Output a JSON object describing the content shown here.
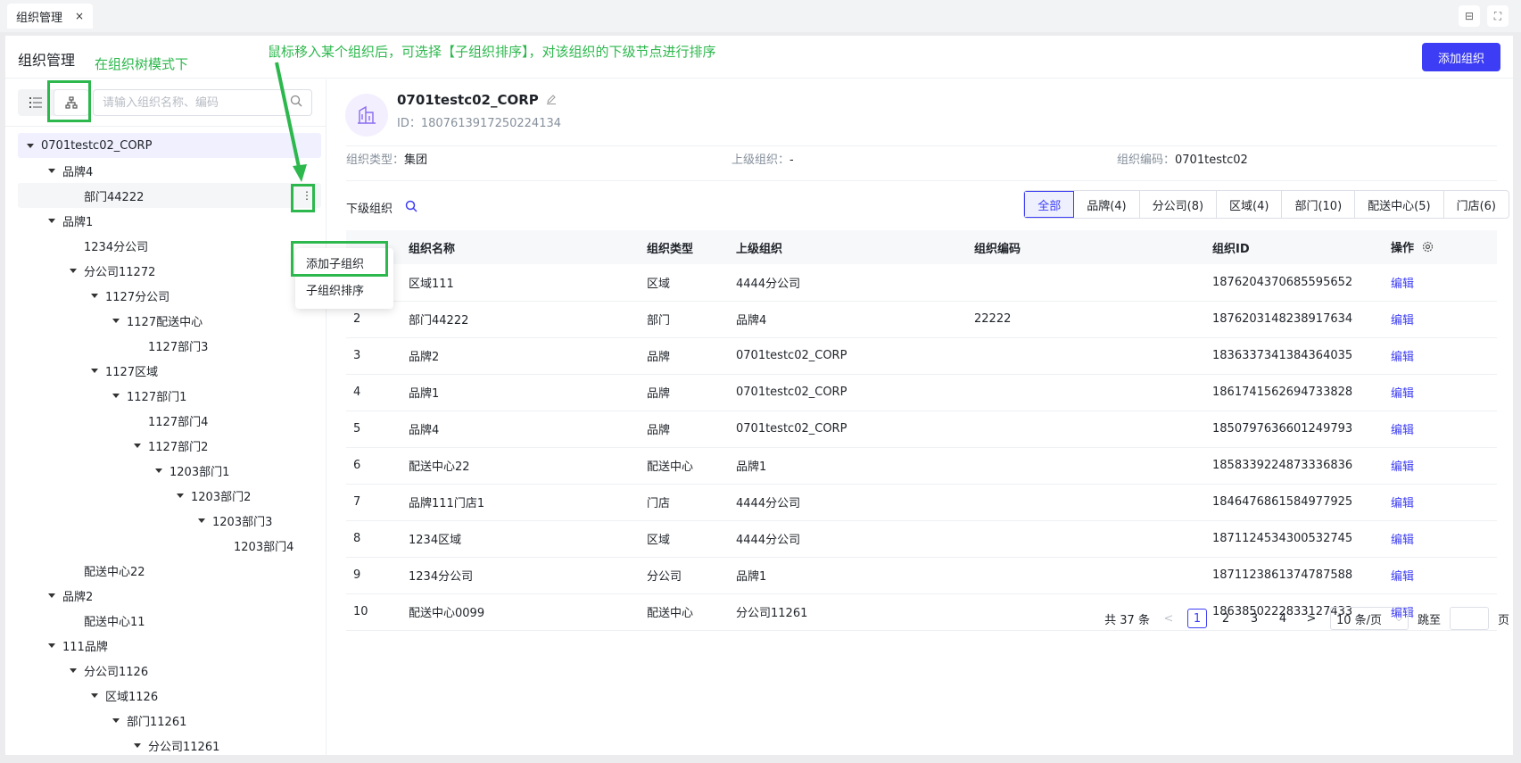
{
  "tab": {
    "label": "组织管理",
    "close": "×"
  },
  "window_buttons": {
    "save_icon": "⊟",
    "expand_icon": "⛶"
  },
  "header": {
    "title": "组织管理",
    "add_button": "添加组织"
  },
  "tree_search": {
    "placeholder": "请输入组织名称、编码"
  },
  "tree": [
    {
      "label": "0701testc02_CORP",
      "level": 0,
      "expandable": true,
      "state": "selected"
    },
    {
      "label": "品牌4",
      "level": 1,
      "expandable": true
    },
    {
      "label": "部门44222",
      "level": 2,
      "expandable": false,
      "state": "hovered"
    },
    {
      "label": "品牌1",
      "level": 1,
      "expandable": true
    },
    {
      "label": "1234分公司",
      "level": 2,
      "expandable": false
    },
    {
      "label": "分公司11272",
      "level": 2,
      "expandable": true
    },
    {
      "label": "1127分公司",
      "level": 3,
      "expandable": true
    },
    {
      "label": "1127配送中心",
      "level": 4,
      "expandable": true
    },
    {
      "label": "1127部门3",
      "level": 5,
      "expandable": false
    },
    {
      "label": "1127区域",
      "level": 3,
      "expandable": true
    },
    {
      "label": "1127部门1",
      "level": 4,
      "expandable": true
    },
    {
      "label": "1127部门4",
      "level": 5,
      "expandable": false
    },
    {
      "label": "1127部门2",
      "level": 5,
      "expandable": true
    },
    {
      "label": "1203部门1",
      "level": 6,
      "expandable": true
    },
    {
      "label": "1203部门2",
      "level": 7,
      "expandable": true
    },
    {
      "label": "1203部门3",
      "level": 8,
      "expandable": true
    },
    {
      "label": "1203部门4",
      "level": 9,
      "expandable": false
    },
    {
      "label": "配送中心22",
      "level": 2,
      "expandable": false
    },
    {
      "label": "品牌2",
      "level": 1,
      "expandable": true
    },
    {
      "label": "配送中心11",
      "level": 2,
      "expandable": false
    },
    {
      "label": "111品牌",
      "level": 1,
      "expandable": true
    },
    {
      "label": "分公司1126",
      "level": 2,
      "expandable": true
    },
    {
      "label": "区域1126",
      "level": 3,
      "expandable": true
    },
    {
      "label": "部门11261",
      "level": 4,
      "expandable": true
    },
    {
      "label": "分公司11261",
      "level": 5,
      "expandable": true
    }
  ],
  "more_icon": "⋮",
  "popup_menu": {
    "items": [
      "添加子组织",
      "子组织排序"
    ]
  },
  "org": {
    "name": "0701testc02_CORP",
    "id_label": "ID：",
    "id": "1807613917250224134",
    "type_label": "组织类型：",
    "type": "集团",
    "parent_label": "上级组织：",
    "parent": "-",
    "code_label": "组织编码：",
    "code": "0701testc02"
  },
  "sub_orgs": {
    "title": "下级组织",
    "filters": [
      "全部",
      "品牌(4)",
      "分公司(8)",
      "区域(4)",
      "部门(10)",
      "配送中心(5)",
      "门店(6)"
    ],
    "columns": [
      "",
      "组织名称",
      "组织类型",
      "上级组织",
      "组织编码",
      "组织ID",
      "操作"
    ],
    "edit_label": "编辑",
    "rows": [
      [
        "1",
        "区域111",
        "区域",
        "4444分公司",
        "",
        "1876204370685595652"
      ],
      [
        "2",
        "部门44222",
        "部门",
        "品牌4",
        "22222",
        "1876203148238917634"
      ],
      [
        "3",
        "品牌2",
        "品牌",
        "0701testc02_CORP",
        "",
        "1836337341384364035"
      ],
      [
        "4",
        "品牌1",
        "品牌",
        "0701testc02_CORP",
        "",
        "1861741562694733828"
      ],
      [
        "5",
        "品牌4",
        "品牌",
        "0701testc02_CORP",
        "",
        "1850797636601249793"
      ],
      [
        "6",
        "配送中心22",
        "配送中心",
        "品牌1",
        "",
        "1858339224873336836"
      ],
      [
        "7",
        "品牌111门店1",
        "门店",
        "4444分公司",
        "",
        "1846476861584977925"
      ],
      [
        "8",
        "1234区域",
        "区域",
        "4444分公司",
        "",
        "1871124534300532745"
      ],
      [
        "9",
        "1234分公司",
        "分公司",
        "品牌1",
        "",
        "1871123861374787588"
      ],
      [
        "10",
        "配送中心0099",
        "配送中心",
        "分公司11261",
        "",
        "1863850222833127433"
      ]
    ]
  },
  "pagination": {
    "total": "共 37 条",
    "prev": "<",
    "pages": [
      "1",
      "2",
      "3",
      "4"
    ],
    "next": ">",
    "page_size": "10 条/页",
    "jump_label": "跳至",
    "page_suffix": "页"
  },
  "annotations": {
    "tree_mode_note": "在组织树模式下",
    "hover_note": "鼠标移入某个组织后，可选择【子组织排序】，对该组织的下级节点进行排序"
  },
  "colors": {
    "accent": "#3d3df5",
    "annotation": "#2db84d"
  }
}
